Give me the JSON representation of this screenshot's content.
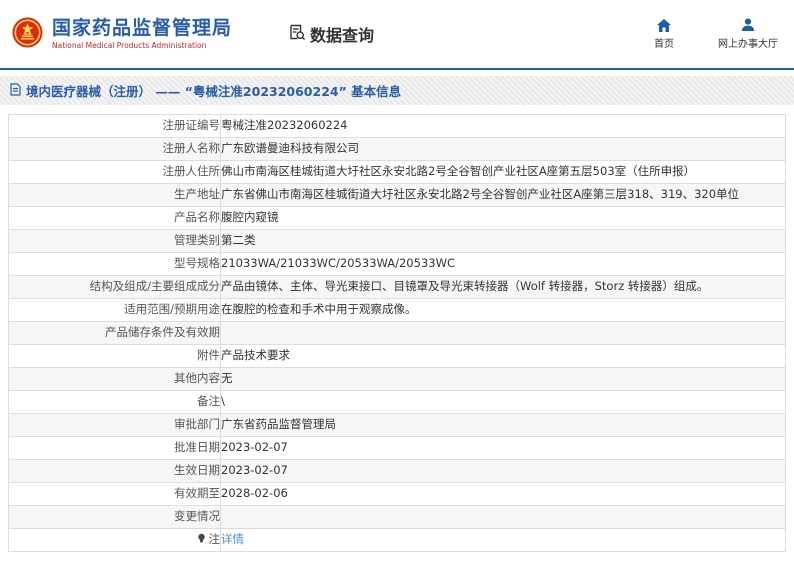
{
  "header": {
    "agency_title": "国家药品监督管理局",
    "agency_subtitle": "National Medical Products Administration",
    "section_label": "数据查询",
    "nav": [
      {
        "label": "首页",
        "icon": "home-icon"
      },
      {
        "label": "网上办事大厅",
        "icon": "user-icon"
      }
    ]
  },
  "breadcrumb": {
    "text": "境内医疗器械（注册） —— “粤械注准20232060224” 基本信息",
    "icon": "document-icon"
  },
  "table": {
    "rows": [
      {
        "label": "注册证编号",
        "value": "粤械注准20232060224"
      },
      {
        "label": "注册人名称",
        "value": "广东欧谱曼迪科技有限公司"
      },
      {
        "label": "注册人住所",
        "value": "佛山市南海区桂城街道大圩社区永安北路2号全谷智创产业社区A座第五层503室（住所申报）"
      },
      {
        "label": "生产地址",
        "value": "广东省佛山市南海区桂城街道大圩社区永安北路2号全谷智创产业社区A座第三层318、319、320单位"
      },
      {
        "label": "产品名称",
        "value": "腹腔内窥镜"
      },
      {
        "label": "管理类别",
        "value": "第二类"
      },
      {
        "label": "型号规格",
        "value": "21033WA/21033WC/20533WA/20533WC"
      },
      {
        "label": "结构及组成/主要组成成分",
        "value": "产品由镜体、主体、导光束接口、目镜罩及导光束转接器（Wolf 转接器，Storz 转接器）组成。"
      },
      {
        "label": "适用范围/预期用途",
        "value": "在腹腔的检查和手术中用于观察成像。"
      },
      {
        "label": "产品储存条件及有效期",
        "value": ""
      },
      {
        "label": "附件",
        "value": "产品技术要求"
      },
      {
        "label": "其他内容",
        "value": "无"
      },
      {
        "label": "备注",
        "value": "\\"
      },
      {
        "label": "审批部门",
        "value": "广东省药品监督管理局"
      },
      {
        "label": "批准日期",
        "value": "2023-02-07"
      },
      {
        "label": "生效日期",
        "value": "2023-02-07"
      },
      {
        "label": "有效期至",
        "value": "2028-02-06"
      },
      {
        "label": "变更情况",
        "value": ""
      },
      {
        "label": "注",
        "label_icon": "bulb-icon",
        "value": "详情",
        "is_link": true
      }
    ]
  },
  "colors": {
    "accent_blue": "#1a5dab",
    "title_blue": "#2a5da8",
    "subtitle_red": "#c1272d",
    "link_blue": "#4a90d9",
    "emblem_red": "#de2a1b",
    "emblem_gold": "#ffd94a",
    "breadcrumb_bg": "#ececec",
    "row_alt_bg": "#f6f6f6",
    "table_border": "#dcdcdc"
  }
}
